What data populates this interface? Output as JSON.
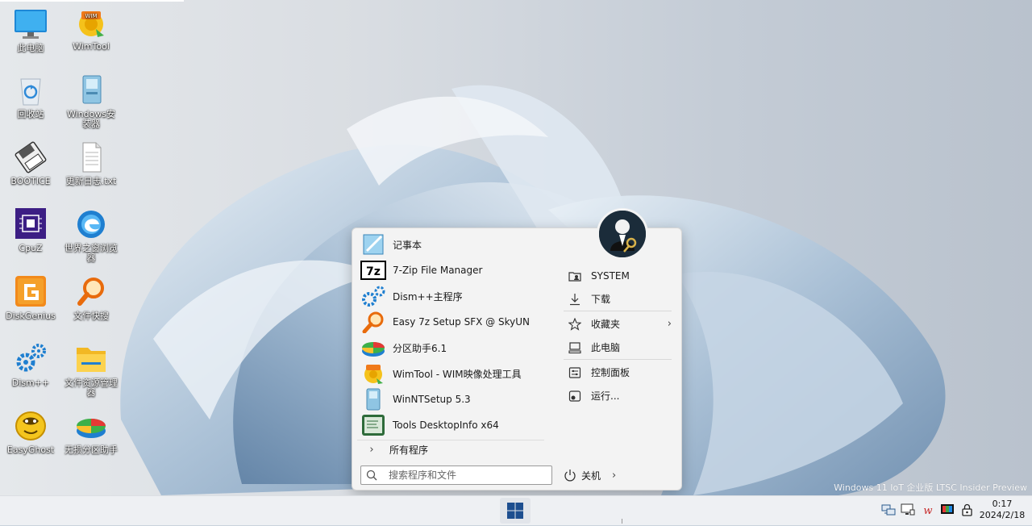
{
  "desktop": {
    "icons": [
      {
        "label": "此电脑"
      },
      {
        "label": "WimTool"
      },
      {
        "label": "回收站"
      },
      {
        "label": "Windows安装器"
      },
      {
        "label": "BOOTICE"
      },
      {
        "label": "更新日志.txt"
      },
      {
        "label": "CpuZ"
      },
      {
        "label": "世界之窗浏览器"
      },
      {
        "label": "DiskGenius"
      },
      {
        "label": "文件快搜"
      },
      {
        "label": "Dism++"
      },
      {
        "label": "文件资源管理器"
      },
      {
        "label": "EasyGhost"
      },
      {
        "label": "无损分区助手"
      }
    ],
    "watermark": "Windows 11 IoT 企业版 LTSC Insider Preview"
  },
  "start_menu": {
    "apps": [
      {
        "label": "记事本",
        "icon": "notepad-icon"
      },
      {
        "label": "7-Zip File Manager",
        "icon": "7zip-icon"
      },
      {
        "label": "Dism++主程序",
        "icon": "dism-icon"
      },
      {
        "label": "Easy 7z Setup SFX @ SkyUN",
        "icon": "magnifier-icon"
      },
      {
        "label": "分区助手6.1",
        "icon": "partition-icon"
      },
      {
        "label": "WimTool - WIM映像处理工具",
        "icon": "wimtool-icon"
      },
      {
        "label": "WinNTSetup 5.3",
        "icon": "winntsetup-icon"
      },
      {
        "label": "Tools DesktopInfo x64",
        "icon": "desktopinfo-icon"
      }
    ],
    "all_programs": "所有程序",
    "right_items": [
      {
        "label": "SYSTEM",
        "icon": "user-folder-icon"
      },
      {
        "label": "下载",
        "icon": "download-icon"
      },
      {
        "label": "收藏夹",
        "icon": "star-icon"
      },
      {
        "label": "此电脑",
        "icon": "computer-icon"
      },
      {
        "label": "控制面板",
        "icon": "control-panel-icon"
      },
      {
        "label": "运行...",
        "icon": "run-icon"
      }
    ],
    "search_placeholder": "搜索程序和文件",
    "power_label": "关机"
  },
  "taskbar": {
    "time": "0:17",
    "date": "2024/2/18"
  }
}
